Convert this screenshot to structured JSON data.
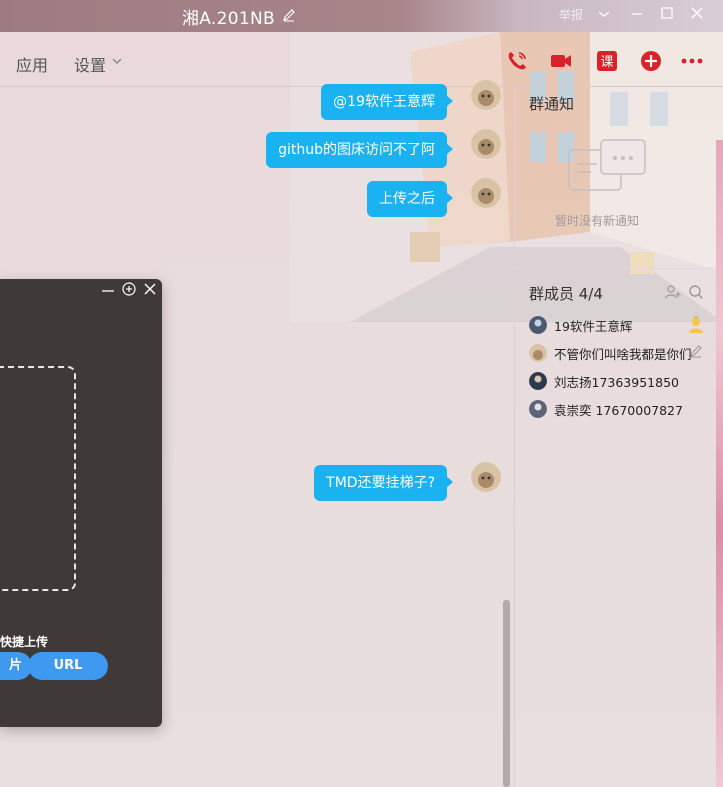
{
  "window": {
    "title": "湘A.201NB",
    "mini_label": "举报"
  },
  "nav": {
    "apps_label": "应用",
    "settings_label": "设置"
  },
  "messages": [
    {
      "text": "@19软件王意辉"
    },
    {
      "text": "github的图床访问不了阿"
    },
    {
      "text": "上传之后"
    },
    {
      "text": "TMD还要挂梯子?"
    }
  ],
  "notice": {
    "title": "群通知",
    "empty_text": "暂时没有新通知"
  },
  "members": {
    "title": "群成员 4/4",
    "items": [
      {
        "name": "19软件王意辉"
      },
      {
        "name": "不管你们叫啥我都是你们"
      },
      {
        "name": "刘志扬17363951850"
      },
      {
        "name": "袁崇奕  17670007827"
      }
    ]
  },
  "upload_dialog": {
    "quick_upload_label": "快捷上传",
    "image_button_label": "片",
    "url_button_label": "URL"
  },
  "colors": {
    "bubble": "#1ab2f1",
    "header_icon_red": "#d8232a",
    "dialog_bg": "#3f3a37",
    "pill_button": "#3e99f0"
  }
}
